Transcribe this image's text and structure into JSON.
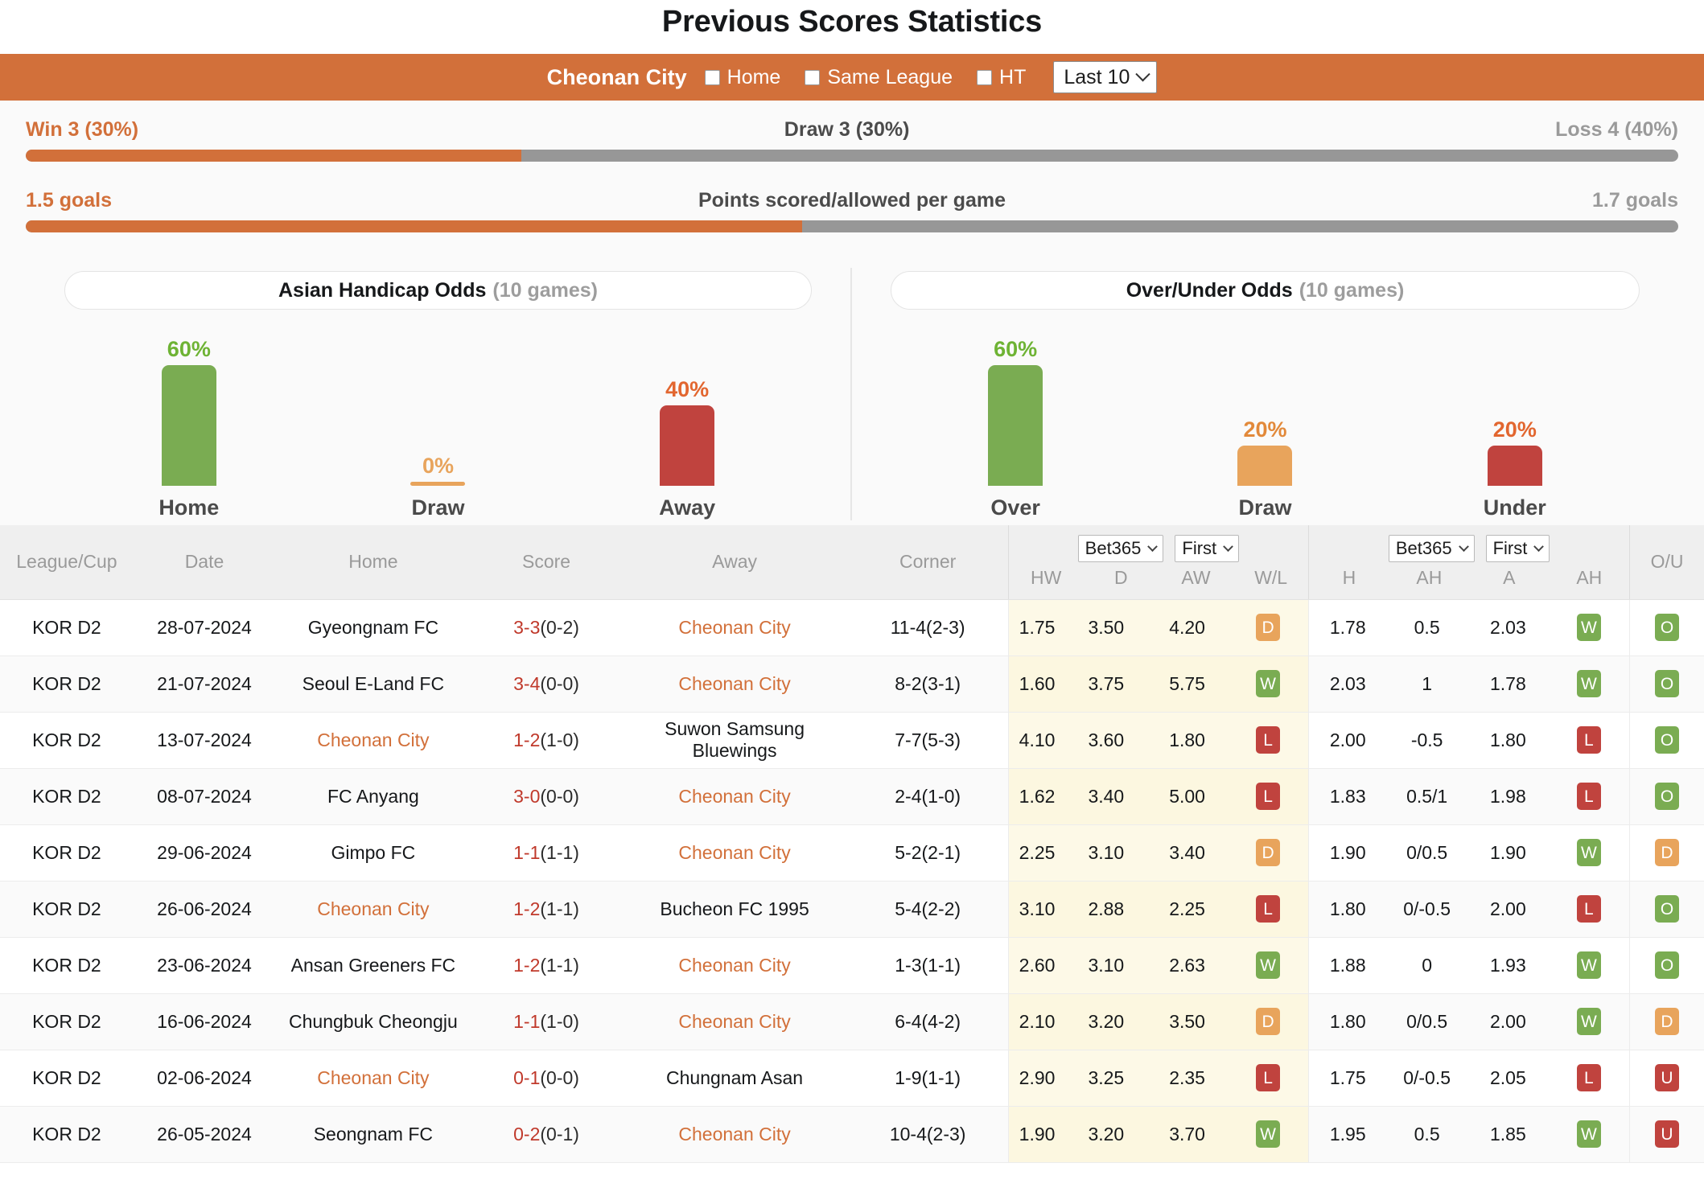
{
  "page_title": "Previous Scores Statistics",
  "filter_bar": {
    "team": "Cheonan City",
    "checkboxes": [
      {
        "label": "Home",
        "checked": false
      },
      {
        "label": "Same League",
        "checked": false
      },
      {
        "label": "HT",
        "checked": false
      }
    ],
    "range_select": {
      "value": "Last 10",
      "icon": "chevron-down-icon"
    }
  },
  "summary": {
    "record": {
      "left": "Win 3 (30%)",
      "middle": "Draw 3 (30%)",
      "right": "Loss 4 (40%)",
      "fill_percent": 30
    },
    "goals": {
      "left": "1.5 goals",
      "middle": "Points scored/allowed per game",
      "right": "1.7 goals",
      "fill_percent": 47
    }
  },
  "odds_panels": [
    {
      "title": "Asian Handicap Odds",
      "games": "(10 games)",
      "bars": [
        {
          "label": "Home",
          "pct_text": "60%",
          "value": 60,
          "color": "#7aac52",
          "pct_color": "#6eb334"
        },
        {
          "label": "Draw",
          "pct_text": "0%",
          "value": 0,
          "color": "#e8a45c",
          "pct_color": "#e8a45c"
        },
        {
          "label": "Away",
          "pct_text": "40%",
          "value": 40,
          "color": "#c0433e",
          "pct_color": "#e2662f"
        }
      ]
    },
    {
      "title": "Over/Under Odds",
      "games": "(10 games)",
      "bars": [
        {
          "label": "Over",
          "pct_text": "60%",
          "value": 60,
          "color": "#7aac52",
          "pct_color": "#6eb334"
        },
        {
          "label": "Draw",
          "pct_text": "20%",
          "value": 20,
          "color": "#e8a45c",
          "pct_color": "#e2893a"
        },
        {
          "label": "Under",
          "pct_text": "20%",
          "value": 20,
          "color": "#c0433e",
          "pct_color": "#e2662f"
        }
      ]
    }
  ],
  "table": {
    "headers": {
      "league": "League/Cup",
      "date": "Date",
      "home": "Home",
      "score": "Score",
      "away": "Away",
      "corner": "Corner",
      "group1": {
        "bookmaker": "Bet365",
        "period": "First",
        "cols": [
          "HW",
          "D",
          "AW",
          "W/L"
        ]
      },
      "group2": {
        "bookmaker": "Bet365",
        "period": "First",
        "cols": [
          "H",
          "AH",
          "A",
          "AH"
        ]
      },
      "ou": "O/U"
    },
    "rows": [
      {
        "league": "KOR D2",
        "date": "28-07-2024",
        "home": "Gyeongnam FC",
        "home_hl": false,
        "score_main": "3-3",
        "score_ht": "(0-2)",
        "away": "Cheonan City",
        "away_hl": true,
        "corner": "11-4(2-3)",
        "hw": "1.75",
        "d": "3.50",
        "aw": "4.20",
        "wl": "D",
        "h": "1.78",
        "ah1": "0.5",
        "a": "2.03",
        "ah2": "W",
        "ou": "O"
      },
      {
        "league": "KOR D2",
        "date": "21-07-2024",
        "home": "Seoul E-Land FC",
        "home_hl": false,
        "score_main": "3-4",
        "score_ht": "(0-0)",
        "away": "Cheonan City",
        "away_hl": true,
        "corner": "8-2(3-1)",
        "hw": "1.60",
        "d": "3.75",
        "aw": "5.75",
        "wl": "W",
        "h": "2.03",
        "ah1": "1",
        "a": "1.78",
        "ah2": "W",
        "ou": "O"
      },
      {
        "league": "KOR D2",
        "date": "13-07-2024",
        "home": "Cheonan City",
        "home_hl": true,
        "score_main": "1-2",
        "score_ht": "(1-0)",
        "away": "Suwon Samsung Bluewings",
        "away_hl": false,
        "corner": "7-7(5-3)",
        "hw": "4.10",
        "d": "3.60",
        "aw": "1.80",
        "wl": "L",
        "h": "2.00",
        "ah1": "-0.5",
        "a": "1.80",
        "ah2": "L",
        "ou": "O"
      },
      {
        "league": "KOR D2",
        "date": "08-07-2024",
        "home": "FC Anyang",
        "home_hl": false,
        "score_main": "3-0",
        "score_ht": "(0-0)",
        "away": "Cheonan City",
        "away_hl": true,
        "corner": "2-4(1-0)",
        "hw": "1.62",
        "d": "3.40",
        "aw": "5.00",
        "wl": "L",
        "h": "1.83",
        "ah1": "0.5/1",
        "a": "1.98",
        "ah2": "L",
        "ou": "O"
      },
      {
        "league": "KOR D2",
        "date": "29-06-2024",
        "home": "Gimpo FC",
        "home_hl": false,
        "score_main": "1-1",
        "score_ht": "(1-1)",
        "away": "Cheonan City",
        "away_hl": true,
        "corner": "5-2(2-1)",
        "hw": "2.25",
        "d": "3.10",
        "aw": "3.40",
        "wl": "D",
        "h": "1.90",
        "ah1": "0/0.5",
        "a": "1.90",
        "ah2": "W",
        "ou": "D"
      },
      {
        "league": "KOR D2",
        "date": "26-06-2024",
        "home": "Cheonan City",
        "home_hl": true,
        "score_main": "1-2",
        "score_ht": "(1-1)",
        "away": "Bucheon FC 1995",
        "away_hl": false,
        "corner": "5-4(2-2)",
        "hw": "3.10",
        "d": "2.88",
        "aw": "2.25",
        "wl": "L",
        "h": "1.80",
        "ah1": "0/-0.5",
        "a": "2.00",
        "ah2": "L",
        "ou": "O"
      },
      {
        "league": "KOR D2",
        "date": "23-06-2024",
        "home": "Ansan Greeners FC",
        "home_hl": false,
        "score_main": "1-2",
        "score_ht": "(1-1)",
        "away": "Cheonan City",
        "away_hl": true,
        "corner": "1-3(1-1)",
        "hw": "2.60",
        "d": "3.10",
        "aw": "2.63",
        "wl": "W",
        "h": "1.88",
        "ah1": "0",
        "a": "1.93",
        "ah2": "W",
        "ou": "O"
      },
      {
        "league": "KOR D2",
        "date": "16-06-2024",
        "home": "Chungbuk Cheongju",
        "home_hl": false,
        "score_main": "1-1",
        "score_ht": "(1-0)",
        "away": "Cheonan City",
        "away_hl": true,
        "corner": "6-4(4-2)",
        "hw": "2.10",
        "d": "3.20",
        "aw": "3.50",
        "wl": "D",
        "h": "1.80",
        "ah1": "0/0.5",
        "a": "2.00",
        "ah2": "W",
        "ou": "D"
      },
      {
        "league": "KOR D2",
        "date": "02-06-2024",
        "home": "Cheonan City",
        "home_hl": true,
        "score_main": "0-1",
        "score_ht": "(0-0)",
        "away": "Chungnam Asan",
        "away_hl": false,
        "corner": "1-9(1-1)",
        "hw": "2.90",
        "d": "3.25",
        "aw": "2.35",
        "wl": "L",
        "h": "1.75",
        "ah1": "0/-0.5",
        "a": "2.05",
        "ah2": "L",
        "ou": "U"
      },
      {
        "league": "KOR D2",
        "date": "26-05-2024",
        "home": "Seongnam FC",
        "home_hl": false,
        "score_main": "0-2",
        "score_ht": "(0-1)",
        "away": "Cheonan City",
        "away_hl": true,
        "corner": "10-4(2-3)",
        "hw": "1.90",
        "d": "3.20",
        "aw": "3.70",
        "wl": "W",
        "h": "1.95",
        "ah1": "0.5",
        "a": "1.85",
        "ah2": "W",
        "ou": "U"
      }
    ]
  },
  "chart_data": [
    {
      "type": "bar",
      "title": "Asian Handicap Odds (10 games)",
      "categories": [
        "Home",
        "Draw",
        "Away"
      ],
      "values": [
        60,
        0,
        40
      ],
      "ylabel": "percent",
      "ylim": [
        0,
        100
      ]
    },
    {
      "type": "bar",
      "title": "Over/Under Odds (10 games)",
      "categories": [
        "Over",
        "Draw",
        "Under"
      ],
      "values": [
        60,
        20,
        20
      ],
      "ylabel": "percent",
      "ylim": [
        0,
        100
      ]
    }
  ]
}
